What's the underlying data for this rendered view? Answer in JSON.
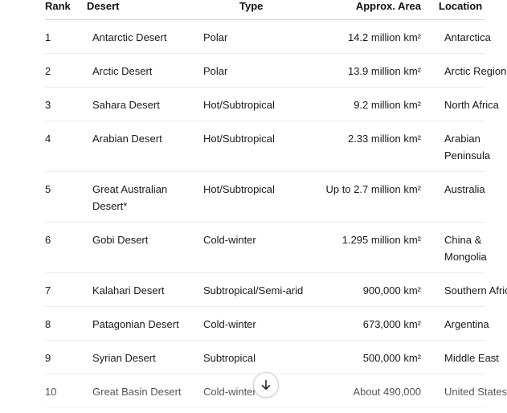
{
  "table": {
    "headers": {
      "rank": "Rank",
      "desert": "Desert",
      "type": "Type",
      "area": "Approx. Area",
      "location": "Location"
    },
    "rows": [
      {
        "rank": "1",
        "desert": "Antarctic Desert",
        "type": "Polar",
        "area": "14.2 million km²",
        "location": "Antarctica"
      },
      {
        "rank": "2",
        "desert": "Arctic Desert",
        "type": "Polar",
        "area": "13.9 million km²",
        "location": "Arctic Region"
      },
      {
        "rank": "3",
        "desert": "Sahara Desert",
        "type": "Hot/Subtropical",
        "area": "9.2 million km²",
        "location": "North Africa"
      },
      {
        "rank": "4",
        "desert": "Arabian Desert",
        "type": "Hot/Subtropical",
        "area": "2.33 million km²",
        "location": "Arabian\nPeninsula"
      },
      {
        "rank": "5",
        "desert": "Great Australian Desert*",
        "type": "Hot/Subtropical",
        "area": "Up to 2.7 million km²",
        "location": "Australia"
      },
      {
        "rank": "6",
        "desert": "Gobi Desert",
        "type": "Cold-winter",
        "area": "1.295 million km²",
        "location": "China &\nMongolia"
      },
      {
        "rank": "7",
        "desert": "Kalahari Desert",
        "type": "Subtropical/Semi-arid",
        "area": "900,000 km²",
        "location": "Southern Africa"
      },
      {
        "rank": "8",
        "desert": "Patagonian Desert",
        "type": "Cold-winter",
        "area": "673,000 km²",
        "location": "Argentina"
      },
      {
        "rank": "9",
        "desert": "Syrian Desert",
        "type": "Subtropical",
        "area": "500,000 km²",
        "location": "Middle East"
      },
      {
        "rank": "10",
        "desert": "Great Basin Desert",
        "type": "Cold-winter",
        "area": "About 490,000",
        "location": "United States"
      }
    ]
  },
  "scroll_button": {
    "icon": "arrow-down-icon"
  }
}
